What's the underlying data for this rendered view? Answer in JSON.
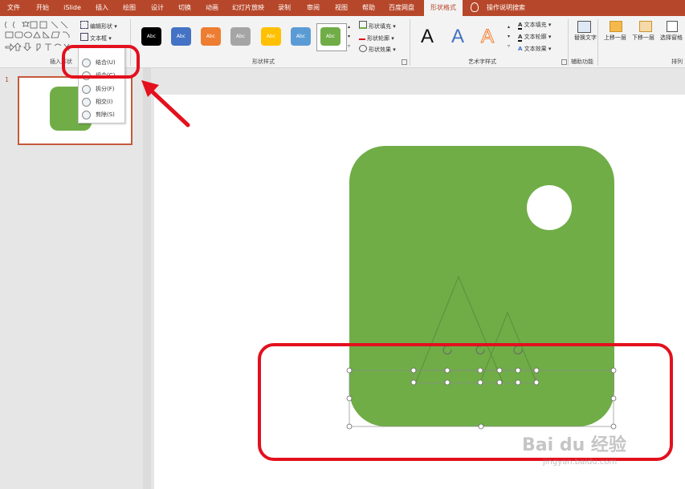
{
  "colors": {
    "accent": "#b7472a",
    "shape_fill": "#70ad47",
    "highlight": "#e3101e"
  },
  "tabs": [
    {
      "label": "文件"
    },
    {
      "label": "开始"
    },
    {
      "label": "iSlide"
    },
    {
      "label": "插入"
    },
    {
      "label": "绘图"
    },
    {
      "label": "设计"
    },
    {
      "label": "切换"
    },
    {
      "label": "动画"
    },
    {
      "label": "幻灯片放映"
    },
    {
      "label": "录制"
    },
    {
      "label": "审阅"
    },
    {
      "label": "视图"
    },
    {
      "label": "帮助"
    },
    {
      "label": "百度网盘"
    },
    {
      "label": "形状格式"
    },
    {
      "label": "操作说明搜索"
    }
  ],
  "ribbon": {
    "insert_shapes": {
      "label": "插入形状",
      "edit_shape": "编辑形状",
      "text_box": "文本框"
    },
    "shape_styles": {
      "label": "形状样式",
      "preset_text": "Abc",
      "fill": "形状填充",
      "outline": "形状轮廓",
      "effects": "形状效果",
      "preset_colors": [
        "#000000",
        "#4472c4",
        "#ed7d31",
        "#a5a5a5",
        "#ffc000",
        "#5b9bd5",
        "#70ad47"
      ]
    },
    "wordart": {
      "label": "艺术字样式",
      "letter": "A",
      "text_fill": "文本填充",
      "text_outline": "文本轮廓",
      "text_effects": "文本效果"
    },
    "accessibility": {
      "label": "辅助功能",
      "alt_text": "替换文字"
    },
    "arrange": {
      "label": "排列",
      "bring_forward": "上移一层",
      "send_backward": "下移一层",
      "selection_pane": "选择窗格"
    }
  },
  "merge_menu": {
    "items": [
      {
        "label": "结合(U)"
      },
      {
        "label": "组合(C)"
      },
      {
        "label": "拆分(F)"
      },
      {
        "label": "相交(I)"
      },
      {
        "label": "剪除(S)"
      }
    ]
  },
  "slides_panel": {
    "slide_number": "1"
  },
  "watermark": {
    "text": "Bai du 经验",
    "url": "jingyan.baidu.com"
  }
}
